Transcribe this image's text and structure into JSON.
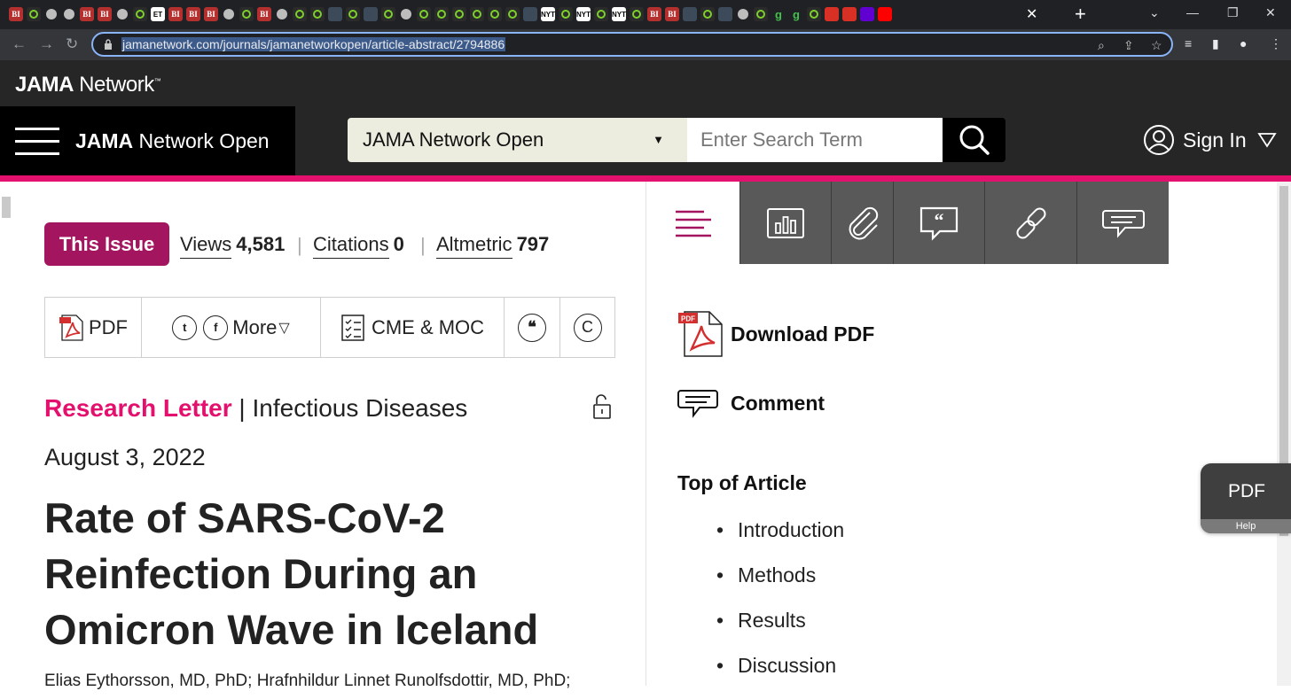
{
  "browser": {
    "url": "jamanetwork.com/journals/jamanetworkopen/article-abstract/2794886",
    "tabs_favicons": [
      "bi-icon",
      "play-icon",
      "globe-icon",
      "globe-icon",
      "bi-icon",
      "bi-icon",
      "globe-icon",
      "play-icon",
      "et-icon",
      "bi-icon",
      "bi-icon",
      "bi-icon",
      "globe-icon",
      "play-icon",
      "bi-icon",
      "globe-icon",
      "play-icon",
      "play-icon",
      "doc-icon",
      "play-icon",
      "doc-icon",
      "play-icon",
      "globe-icon",
      "play-icon",
      "play-icon",
      "play-icon",
      "check-icon",
      "play-icon",
      "play-icon",
      "doc-icon",
      "nyt-icon",
      "play-icon",
      "nyt-icon",
      "play-icon",
      "nyt-icon",
      "play-icon",
      "bi-icon",
      "bi-icon",
      "doc-icon",
      "play-icon",
      "doc-icon",
      "globe-icon",
      "play-icon",
      "g-icon",
      "g-icon",
      "play-icon",
      "red-icon",
      "bookmark-icon",
      "yahoo-icon",
      "youtube-icon",
      "mail-icon",
      "close-icon",
      "globe-icon"
    ],
    "tab_labels": {
      "bi": "BI",
      "et": "ET",
      "g": "g",
      "nyt": "NYT"
    }
  },
  "network": {
    "brand_bold": "JAMA",
    "brand_rest": " Network",
    "tm": "™"
  },
  "header": {
    "journal_bold": "JAMA",
    "journal_rest": " Network Open",
    "search_select": "JAMA Network Open",
    "search_placeholder": "Enter Search Term",
    "sign_in": "Sign In"
  },
  "metrics": {
    "this_issue": "This Issue",
    "views_label": "Views",
    "views_value": "4,581",
    "citations_label": "Citations",
    "citations_value": "0",
    "altmetric_label": "Altmetric",
    "altmetric_value": "797"
  },
  "actions": {
    "pdf": "PDF",
    "more": "More",
    "cme": "CME & MOC"
  },
  "article": {
    "type": "Research Letter",
    "category": "Infectious Diseases",
    "date": "August 3, 2022",
    "title": "Rate of SARS-CoV-2 Reinfection During an Omicron Wave in Iceland",
    "authors": "Elias Eythorsson, MD, PhD; Hrafnhildur Linnet Runolfsdottir, MD, PhD;"
  },
  "sidebar": {
    "download_pdf": "Download PDF",
    "comment": "Comment",
    "toc_heading": "Top of Article",
    "toc": [
      "Introduction",
      "Methods",
      "Results",
      "Discussion"
    ]
  },
  "float_widget": {
    "label": "PDF",
    "help": "Help"
  },
  "colors": {
    "brand_pink": "#e4106e",
    "this_issue_bg": "#a3165f",
    "tab_gray": "#595959"
  }
}
